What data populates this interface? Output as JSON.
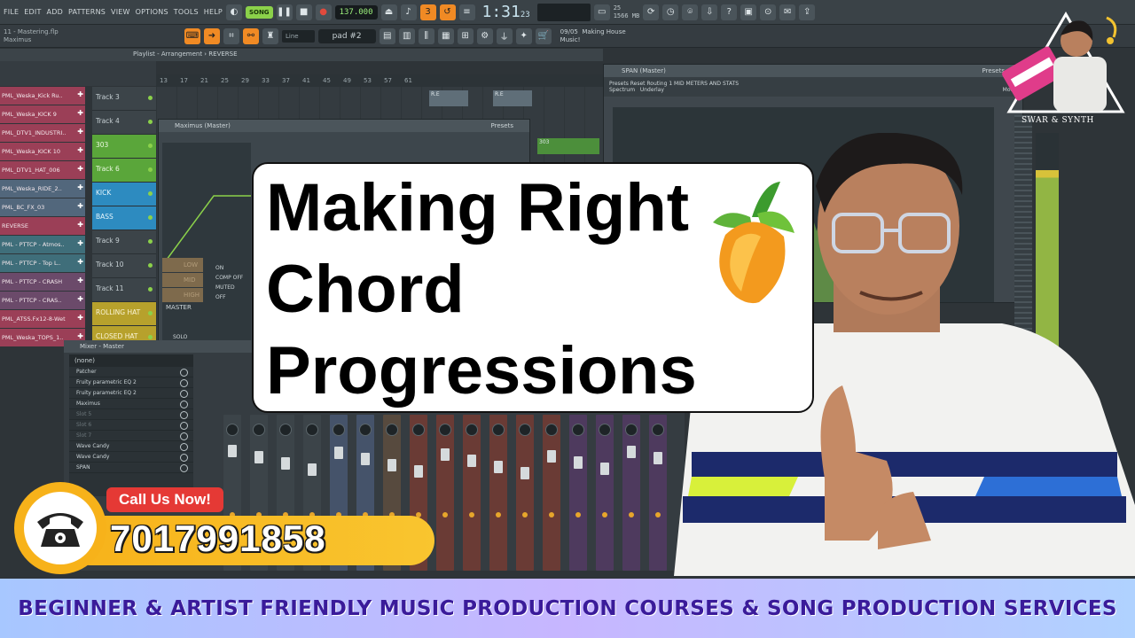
{
  "menu": [
    "FILE",
    "EDIT",
    "ADD",
    "PATTERNS",
    "VIEW",
    "OPTIONS",
    "TOOLS",
    "HELP"
  ],
  "transport": {
    "mode": "SONG",
    "tempo": "137.000",
    "time": "1:31",
    "time_sub": "23",
    "cpu": "25",
    "ram": "1566 MB"
  },
  "project": {
    "file": "11 - Mastering.flp",
    "plugin": "Maximus"
  },
  "pattern": {
    "name": "pad #2",
    "snap": "Line"
  },
  "hint": {
    "date": "09/05",
    "line1": "Making House",
    "line2": "Music!"
  },
  "playlist": {
    "header": "Playlist - Arrangement › REVERSE",
    "ruler": [
      "13",
      "17",
      "21",
      "25",
      "29",
      "33",
      "37",
      "41",
      "45",
      "49",
      "53",
      "57",
      "61"
    ],
    "channels": [
      "PML_Weska_Kick Ru..",
      "PML_Weska_KICK 9",
      "PML_DTV1_INDUSTRI..",
      "PML_Weska_KICK 10",
      "PML_DTV1_HAT_006",
      "PML_Weska_RIDE_2..",
      "PML_BC_FX_03",
      "REVERSE",
      "PML - PTTCP - Atmos..",
      "PML - PTTCP - Top L..",
      "PML - PTTCP - CRASH",
      "PML - PTTCP - CRAS..",
      "PML_ATSS.Fx12-8-Wet",
      "PML_Weska_TOPS_1.."
    ],
    "tracks": [
      "Track 3",
      "Track 4",
      "303",
      "Track 6",
      "KICK",
      "BASS",
      "Track 9",
      "Track 10",
      "Track 11",
      "ROLLING HAT",
      "CLOSED HAT"
    ],
    "clips": [
      "R.E",
      "R.E",
      "303",
      "303"
    ]
  },
  "maximus": {
    "title": "Maximus (Master)",
    "presets": "Presets",
    "bands": [
      "LOW",
      "MID",
      "HIGH"
    ],
    "master": "MASTER",
    "modes": [
      "ON",
      "COMP OFF",
      "MUTED",
      "OFF"
    ],
    "solo": "SOLO"
  },
  "span": {
    "title": "SPAN (Master)",
    "presets": "Presets",
    "tools": "Presets   Reset   Routing   1   MID METERS AND STATS",
    "spectrum": "Spectrum",
    "underlay": "Underlay",
    "mode": "Mode"
  },
  "mixer": {
    "title": "Mixer - Master",
    "select": "(none)",
    "fx": [
      "Patcher",
      "Fruity parametric EQ 2",
      "Fruity parametric EQ 2",
      "Maximus",
      "Slot 5",
      "Slot 6",
      "Slot 7",
      "Wave Candy",
      "Wave Candy",
      "SPAN"
    ],
    "fx_dim": [
      false,
      false,
      false,
      false,
      true,
      true,
      true,
      false,
      false,
      false
    ]
  },
  "title_card": {
    "line1": "Making Right",
    "line2": "Chord",
    "line3": "Progressions"
  },
  "brand": {
    "name": "SWAR & SYNTH"
  },
  "call": {
    "label": "Call Us Now!",
    "number": "7017991858"
  },
  "banner": {
    "text": "BEGINNER & ARTIST FRIENDLY MUSIC PRODUCTION COURSES & SONG PRODUCTION SERVICES"
  },
  "colors": {
    "accent": "#f08a24",
    "call_yellow": "#f7b21a",
    "call_red": "#e53935",
    "banner_text": "#3a1b9a",
    "track_green": "#5aa63a",
    "track_blue": "#2d8bc0"
  }
}
